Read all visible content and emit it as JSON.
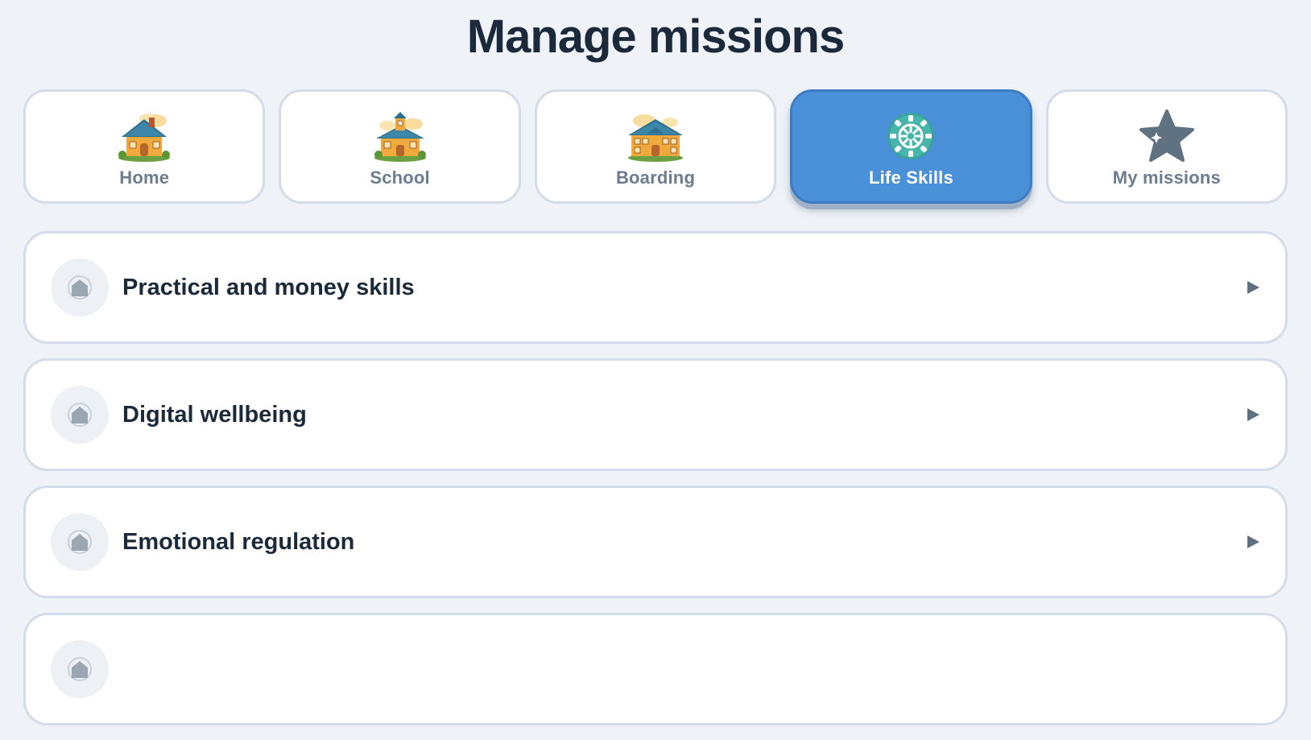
{
  "header": {
    "title": "Manage missions"
  },
  "tabs": [
    {
      "label": "Home",
      "icon": "house-icon",
      "active": false
    },
    {
      "label": "School",
      "icon": "schoolhouse-icon",
      "active": false
    },
    {
      "label": "Boarding",
      "icon": "boarding-house-icon",
      "active": false
    },
    {
      "label": "Life Skills",
      "icon": "lifebuoy-wheel-icon",
      "active": true
    },
    {
      "label": "My missions",
      "icon": "star-icon",
      "active": false
    }
  ],
  "missions": [
    {
      "label": "Practical and money skills",
      "icon": "category-house-icon"
    },
    {
      "label": "Digital wellbeing",
      "icon": "category-house-icon"
    },
    {
      "label": "Emotional regulation",
      "icon": "category-house-icon"
    },
    {
      "label": "",
      "icon": "category-house-icon"
    }
  ],
  "colors": {
    "background": "#eff3f8",
    "active_tab": "#4a90d9",
    "card_border": "#d3dce8",
    "title_text": "#1b2a3b",
    "muted_text": "#6b7c8f",
    "arrow": "#5e7080"
  }
}
